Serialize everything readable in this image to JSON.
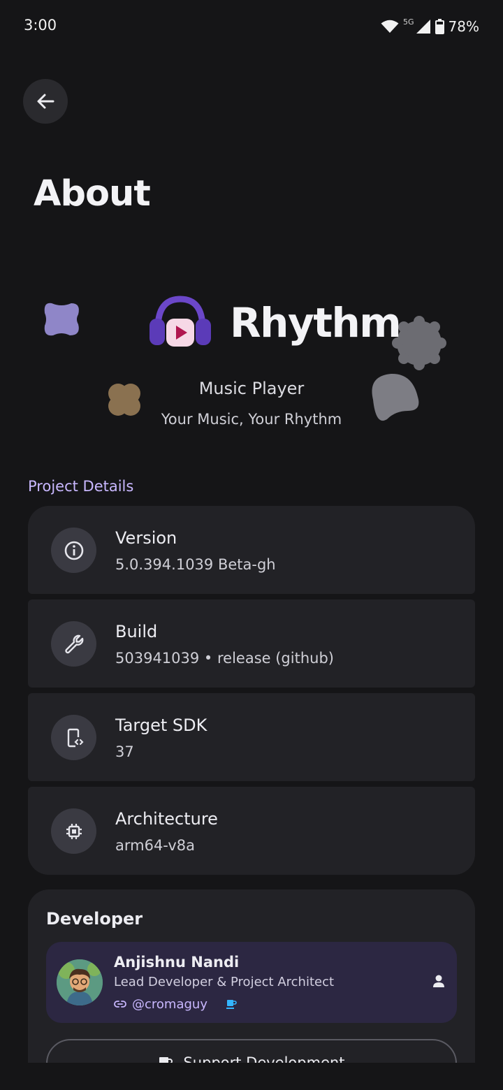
{
  "status_bar": {
    "time": "3:00",
    "network": "5G",
    "battery": "78%",
    "icons": [
      "wifi-icon",
      "cell-signal-icon",
      "battery-icon"
    ]
  },
  "header": {
    "title": "About",
    "back_icon": "arrow-back-icon"
  },
  "app": {
    "name": "Rhythm",
    "subtitle": "Music Player",
    "tagline": "Your Music, Your Rhythm",
    "logo_icon": "headphones-play-icon"
  },
  "project_details": {
    "label": "Project Details",
    "items": [
      {
        "title": "Version",
        "value": "5.0.394.1039 Beta-gh",
        "icon": "info-icon"
      },
      {
        "title": "Build",
        "value": "503941039 • release (github)",
        "icon": "wrench-icon"
      },
      {
        "title": "Target SDK",
        "value": "37",
        "icon": "phone-code-icon"
      },
      {
        "title": "Architecture",
        "value": "arm64-v8a",
        "icon": "chip-icon"
      }
    ]
  },
  "developer": {
    "heading": "Developer",
    "name": "Anjishnu Nandi",
    "role": "Lead Developer & Project Architect",
    "handle": "@cromaguy",
    "support_label": "Support Development"
  },
  "colors": {
    "background": "#151517",
    "card": "#222226",
    "accent": "#c9b8ff",
    "profile_card": "#2c2742"
  }
}
